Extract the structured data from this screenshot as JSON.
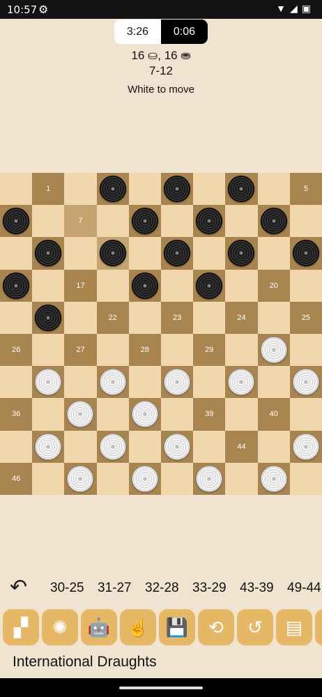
{
  "status_bar": {
    "time": "10:57",
    "settings_icon": "gear-icon",
    "right_icons": "▼◢▣"
  },
  "clock": {
    "white_time": "3:26",
    "black_time": "0:06"
  },
  "score": "16 ⛀, 16 ⛂",
  "last_move": "7-12",
  "turn_text": "White to move",
  "board": {
    "size": 10,
    "light_color": "#f0d8ac",
    "dark_color": "#a8844f",
    "highlight_color": "#c6a470",
    "black_pieces": [
      2,
      3,
      4,
      6,
      8,
      9,
      10,
      11,
      12,
      13,
      14,
      15,
      16,
      18,
      19,
      21
    ],
    "white_pieces": [
      30,
      31,
      32,
      33,
      34,
      35,
      37,
      38,
      41,
      42,
      43,
      45,
      47,
      48,
      49,
      50
    ],
    "highlighted": [
      7,
      12
    ],
    "labels": {
      "1": "1",
      "5": "5",
      "7": "7",
      "17": "17",
      "20": "20",
      "22": "22",
      "23": "23",
      "24": "24",
      "25": "25",
      "26": "26",
      "27": "27",
      "28": "28",
      "29": "29",
      "36": "36",
      "39": "39",
      "40": "40",
      "44": "44",
      "46": "46"
    }
  },
  "moves": [
    "30-25",
    "31-27",
    "32-28",
    "33-29",
    "43-39",
    "49-44"
  ],
  "toolbar": [
    {
      "name": "board-setup-icon",
      "glyph": "▞"
    },
    {
      "name": "brain-icon",
      "glyph": "✺"
    },
    {
      "name": "android-icon",
      "glyph": "🤖"
    },
    {
      "name": "hand-icon",
      "glyph": "☝"
    },
    {
      "name": "save-icon",
      "glyph": "💾"
    },
    {
      "name": "history-icon",
      "glyph": "⟲"
    },
    {
      "name": "restore-icon",
      "glyph": "↺"
    },
    {
      "name": "notation-icon",
      "glyph": "▤"
    },
    {
      "name": "more-icon",
      "glyph": "▌"
    }
  ],
  "app_name": "International Draughts"
}
